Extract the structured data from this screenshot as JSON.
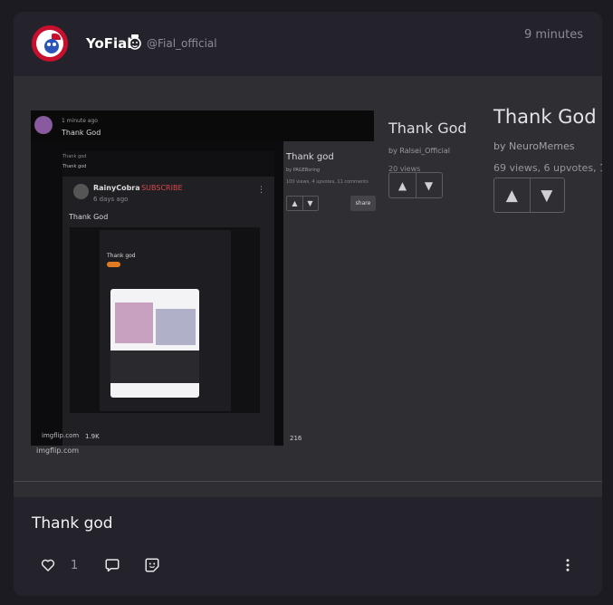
{
  "post": {
    "display_name": "YoFial",
    "handle": "@Fial_official",
    "timestamp": "9 minutes",
    "caption": "Thank god",
    "like_count": "1"
  },
  "embed": {
    "small": {
      "title": "Thank god",
      "by": "by PAGEBoring",
      "stats": "100 views, 4 upvotes, 11 comments",
      "share": "share"
    },
    "medium": {
      "title": "Thank God",
      "by": "by Ralsei_Official",
      "stats": "20 views"
    },
    "large": {
      "title": "Thank God",
      "by": "by NeuroMemes",
      "stats": "69 views, 6 upvotes, 1"
    },
    "meme": {
      "top_meta": "1 minute ago",
      "top_title": "Thank God",
      "inner_meta": "Thank god",
      "inner_sub": "Thank god",
      "rainy_name": "RainyCobra",
      "rainy_subscribe": "· SUBSCRIBE",
      "rainy_age": "6 days ago",
      "rainy_text": "Thank God",
      "nested_title": "Thank god",
      "likes": "1.9K",
      "comments": "216",
      "watermark1": "imgflip.com",
      "watermark2": "imgflip.com"
    }
  },
  "colors": {
    "card": "#24232b",
    "background": "#1c1b22",
    "media": "#2f2f33",
    "avatar_ring": "#c8102e"
  },
  "icons": [
    "heart-icon",
    "comment-icon",
    "sticker-icon",
    "more-vertical-icon",
    "upvote-icon",
    "downvote-icon",
    "mascot-badge-icon"
  ]
}
